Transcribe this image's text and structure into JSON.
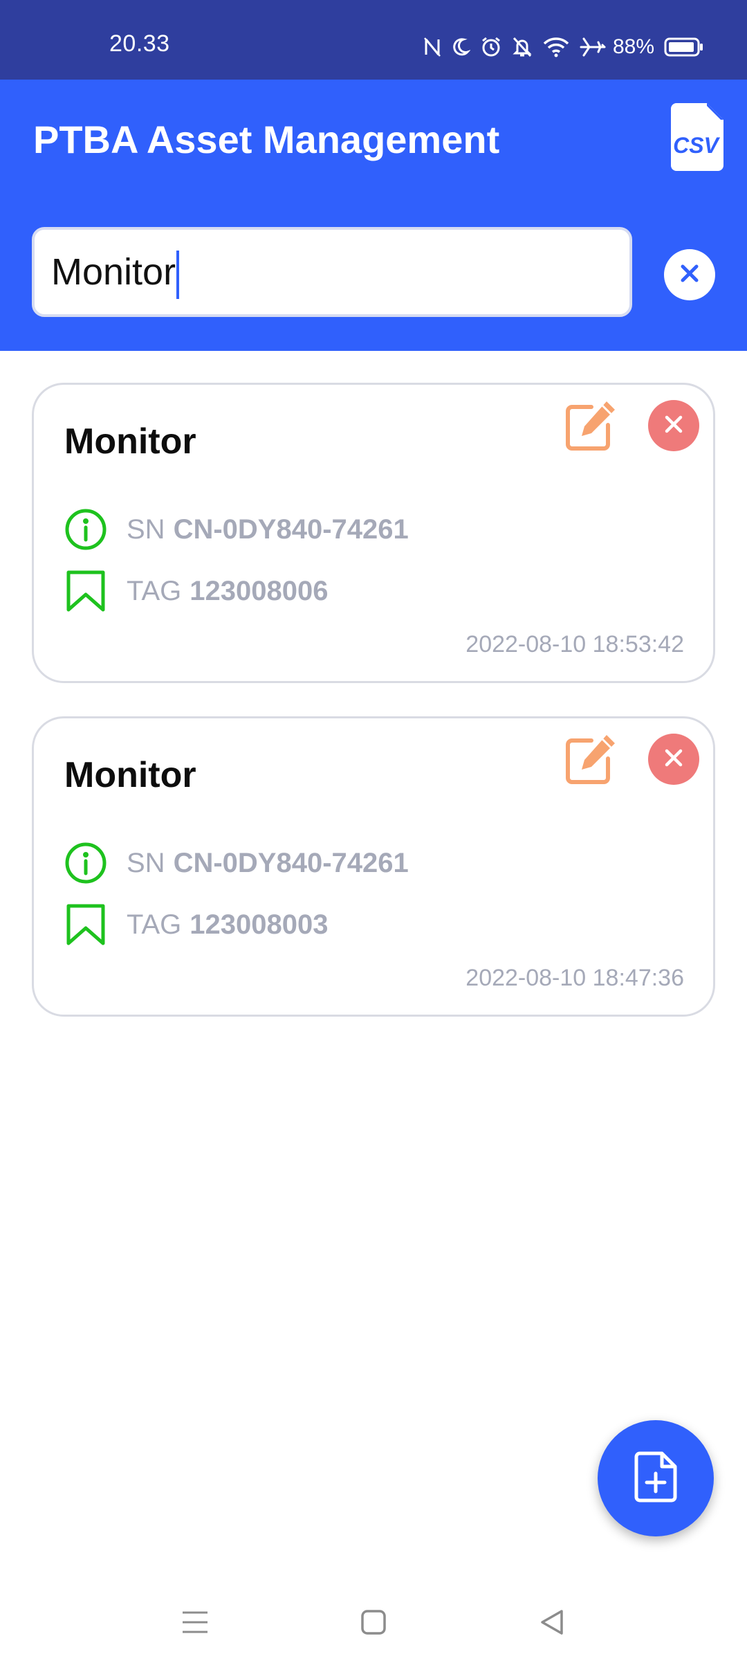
{
  "status_bar": {
    "time": "20.33",
    "battery": "88%",
    "icons": [
      "nfc-icon",
      "moon-icon",
      "alarm-icon",
      "bell-off-icon",
      "wifi-icon",
      "airplane-icon",
      "battery-icon"
    ]
  },
  "app_bar": {
    "title": "PTBA Asset Management",
    "export_icon": "csv-file-icon"
  },
  "search": {
    "value": "Monitor",
    "clear_icon": "close-icon"
  },
  "assets": [
    {
      "name": "Monitor",
      "sn_label": "SN",
      "sn": "CN-0DY840-74261",
      "tag_label": "TAG",
      "tag": "123008006",
      "timestamp": "2022-08-10 18:53:42"
    },
    {
      "name": "Monitor",
      "sn_label": "SN",
      "sn": "CN-0DY840-74261",
      "tag_label": "TAG",
      "tag": "123008003",
      "timestamp": "2022-08-10 18:47:36"
    }
  ],
  "fab": {
    "icon": "add-document-icon"
  },
  "nav_bar": {
    "icons": [
      "menu-icon",
      "home-icon",
      "back-icon"
    ]
  },
  "colors": {
    "status_bar": "#2f3e9e",
    "primary": "#3060fc",
    "edit": "#f7a36f",
    "delete": "#ef7a7a",
    "info": "#1ec21e",
    "muted_text": "#a5a9b8"
  }
}
